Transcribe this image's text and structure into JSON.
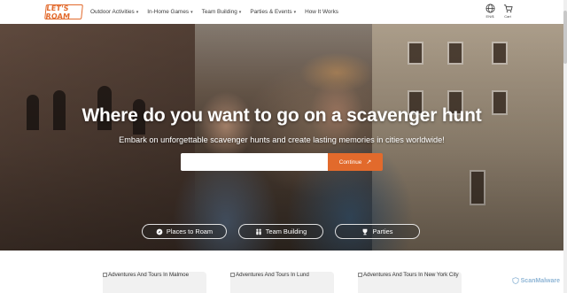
{
  "header": {
    "logo_text": "LET'S ROAM",
    "nav": [
      {
        "label": "Outdoor Activities"
      },
      {
        "label": "In-Home Games"
      },
      {
        "label": "Team Building"
      },
      {
        "label": "Parties & Events"
      },
      {
        "label": "How It Works"
      }
    ],
    "language_label": "EN/$",
    "cart_label": "Cart"
  },
  "hero": {
    "title": "Where do you want to go on a scavenger hunt",
    "subtitle": "Embark on unforgettable scavenger hunts and create lasting memories in cities worldwide!",
    "search_value": "",
    "search_placeholder": "",
    "continue_label": "Continue",
    "pills": [
      {
        "label": "Places to Roam",
        "icon": "compass-icon"
      },
      {
        "label": "Team Building",
        "icon": "people-icon"
      },
      {
        "label": "Parties",
        "icon": "trophy-icon"
      }
    ]
  },
  "cards": [
    {
      "alt": "Adventures And Tours In Malmoe"
    },
    {
      "alt": "Adventures And Tours In Lund"
    },
    {
      "alt": "Adventures And Tours In New York City"
    }
  ],
  "watermark": "ScanMalware",
  "colors": {
    "accent": "#e26a2c",
    "text": "#3b3b3b"
  }
}
